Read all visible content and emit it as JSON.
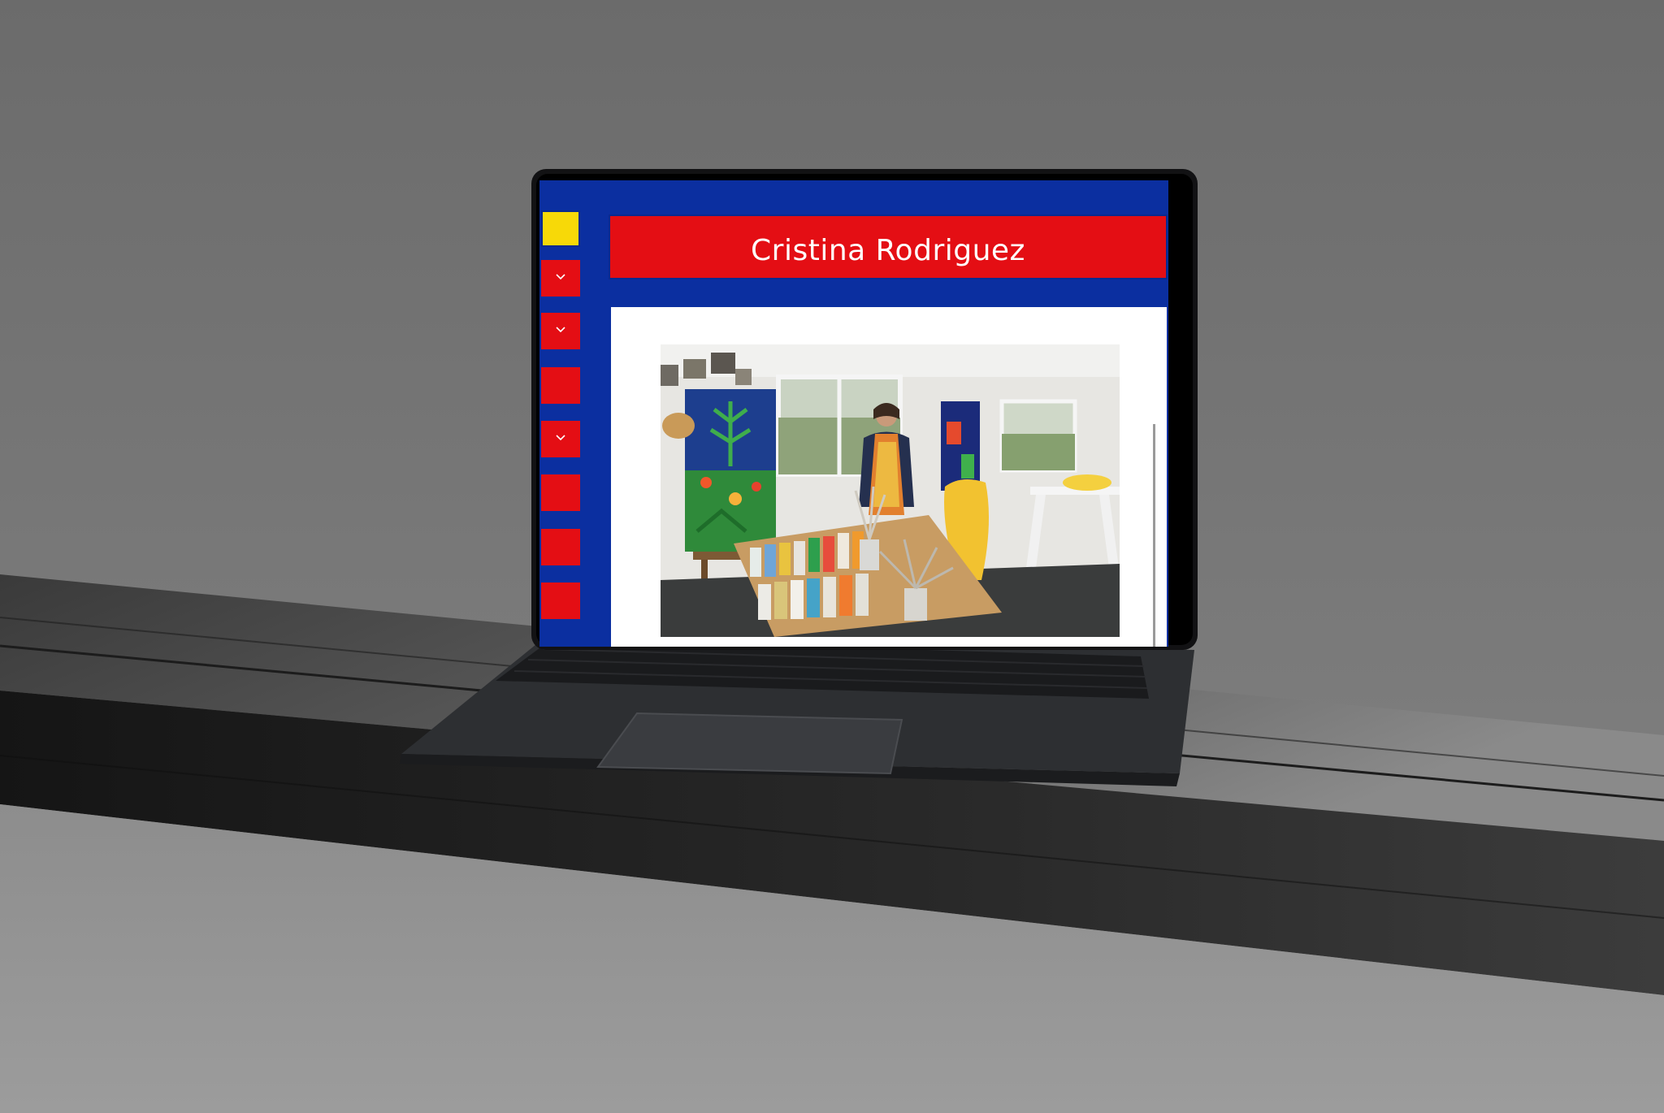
{
  "site": {
    "artist_name": "Cristina Rodriguez"
  },
  "sidebar": {
    "items": [
      {
        "icon": "chevron-down-icon",
        "has_dropdown": true
      },
      {
        "icon": "chevron-down-icon",
        "has_dropdown": true
      },
      {
        "icon": "",
        "has_dropdown": false
      },
      {
        "icon": "chevron-down-icon",
        "has_dropdown": true
      },
      {
        "icon": "",
        "has_dropdown": false
      },
      {
        "icon": "",
        "has_dropdown": false
      },
      {
        "icon": "",
        "has_dropdown": false
      }
    ]
  },
  "colors": {
    "frame_blue": "#0b2fa0",
    "header_red": "#e40e14",
    "logo_yellow": "#f7d908",
    "content_white": "#ffffff",
    "background_gray": "#7a7a7a"
  }
}
